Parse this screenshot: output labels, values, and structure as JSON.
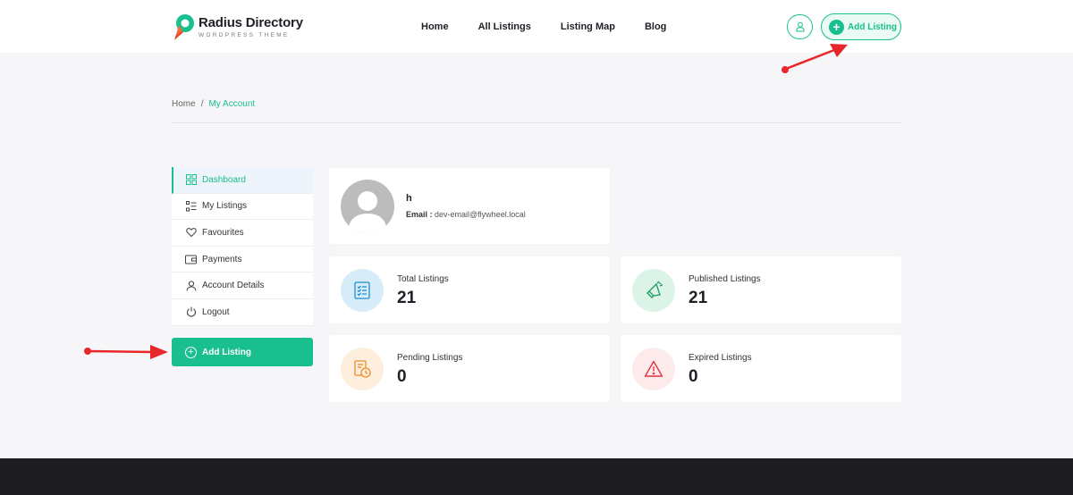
{
  "brand": {
    "title": "Radius Directory",
    "subtitle": "WORDPRESS THEME",
    "accent": "#19bf8e"
  },
  "nav": {
    "items": [
      {
        "label": "Home"
      },
      {
        "label": "All Listings"
      },
      {
        "label": "Listing Map"
      },
      {
        "label": "Blog"
      }
    ],
    "add_listing_label": "Add Listing"
  },
  "breadcrumb": {
    "home": "Home",
    "separator": "/",
    "current": "My Account"
  },
  "sidebar": {
    "items": [
      {
        "label": "Dashboard",
        "icon": "dashboard-grid-icon"
      },
      {
        "label": "My Listings",
        "icon": "list-icon"
      },
      {
        "label": "Favourites",
        "icon": "heart-icon"
      },
      {
        "label": "Payments",
        "icon": "wallet-icon"
      },
      {
        "label": "Account Details",
        "icon": "user-icon"
      },
      {
        "label": "Logout",
        "icon": "power-icon"
      }
    ],
    "add_listing_label": "Add Listing"
  },
  "profile": {
    "name": "h",
    "email_label": "Email :",
    "email": "dev-email@flywheel.local"
  },
  "stats": [
    {
      "label": "Total Listings",
      "value": "21",
      "icon": "checklist-icon",
      "bg": "#d6ecf8",
      "color": "#1e8fd0"
    },
    {
      "label": "Published Listings",
      "value": "21",
      "icon": "megaphone-icon",
      "bg": "#dcf4e8",
      "color": "#1c9b5f"
    },
    {
      "label": "Pending Listings",
      "value": "0",
      "icon": "pending-clock-icon",
      "bg": "#fdeedd",
      "color": "#ef8a28"
    },
    {
      "label": "Expired Listings",
      "value": "0",
      "icon": "warning-triangle-icon",
      "bg": "#fdebec",
      "color": "#e53444"
    }
  ]
}
